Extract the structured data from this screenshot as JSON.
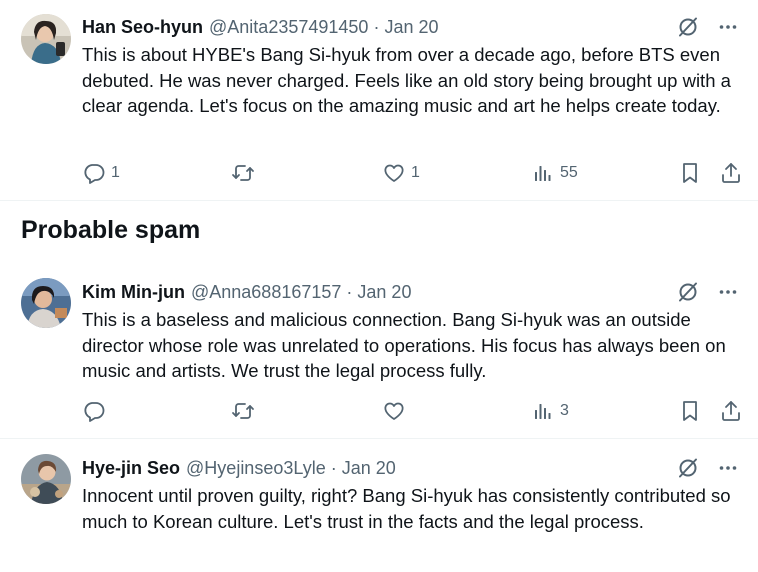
{
  "section": {
    "title": "Probable spam"
  },
  "tweets": [
    {
      "name": "Han Seo-hyun",
      "handle": "@Anita2357491450",
      "separator": "·",
      "date": "Jan 20",
      "text": "This is about HYBE's Bang Si-hyuk from over a decade ago, before BTS even debuted. He was never charged. Feels like an old story being brought up with a clear agenda. Let's focus on the amazing music and art he helps create today.",
      "replies": "1",
      "reposts": "",
      "likes": "1",
      "views": "55"
    },
    {
      "name": "Kim Min-jun",
      "handle": "@Anna688167157",
      "separator": "·",
      "date": "Jan 20",
      "text": "This is a baseless and malicious connection. Bang Si-hyuk was an outside director whose role was unrelated to operations. His focus has always been on music and artists. We trust the legal process fully.",
      "replies": "",
      "reposts": "",
      "likes": "",
      "views": "3"
    },
    {
      "name": "Hye-jin Seo",
      "handle": "@Hyejinseo3Lyle",
      "separator": "·",
      "date": "Jan 20",
      "text": "Innocent until proven guilty, right? Bang Si-hyuk has consistently contributed so much to Korean culture. Let's trust in the facts and the legal process."
    }
  ],
  "icons": {
    "grok": "grok-icon",
    "more": "more-icon",
    "reply": "reply-icon",
    "repost": "repost-icon",
    "like": "like-icon",
    "views": "views-icon",
    "bookmark": "bookmark-icon",
    "share": "share-icon"
  },
  "colors": {
    "text": "#0f1419",
    "secondary": "#536471",
    "divider": "#eff3f4"
  }
}
